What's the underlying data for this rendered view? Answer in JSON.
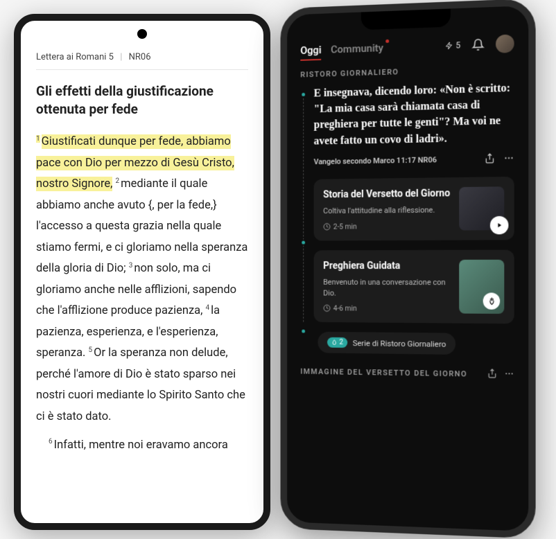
{
  "left": {
    "book_ref": "Lettera ai Romani 5",
    "version": "NR06",
    "heading": "Gli effetti della giustificazione ottenuta per fede",
    "v1": "Giustificati dunque per fede, abbiamo pace con Dio per mezzo di Gesù Cristo, nostro Signore,",
    "v2a": "mediante il quale abbiamo anche avuto {, per la fede,} l'accesso a questa grazia nella quale stiamo fermi, e ci gloriamo nella speranza della gloria di Dio; ",
    "v3a": "non solo, ma ci gloriamo anche nelle afflizioni, sapendo che l'afflizione produce pazienza, ",
    "v4a": "la pazienza, esperienza, e l'esperienza, speranza. ",
    "v5a": "Or la speranza non delude, perché l'amore di Dio è stato sparso nei nostri cuori mediante lo Spirito Santo che ci è stato dato.",
    "v6a": "Infatti, mentre noi eravamo ancora"
  },
  "right": {
    "tabs": {
      "today": "Oggi",
      "community": "Community"
    },
    "streak_count": "5",
    "section_daily": "RISTORO GIORNALIERO",
    "verse": "E insegnava, dicendo loro: «Non è scritto: \"La mia casa sarà chiamata casa di preghiera per tutte le genti\"? Ma voi ne avete fatto un covo di ladri».",
    "verse_ref": "Vangelo secondo Marco 11:17 NR06",
    "card1": {
      "title": "Storia del Versetto del Giorno",
      "sub": "Coltiva l'attitudine alla riflessione.",
      "time": "2-5 min"
    },
    "card2": {
      "title": "Preghiera Guidata",
      "sub": "Benvenuto in una conversazione con Dio.",
      "time": "4-6 min"
    },
    "series": {
      "count": "2",
      "label": "Serie di Ristoro Giornaliero"
    },
    "section_image": "IMMAGINE DEL VERSETTO DEL GIORNO"
  }
}
